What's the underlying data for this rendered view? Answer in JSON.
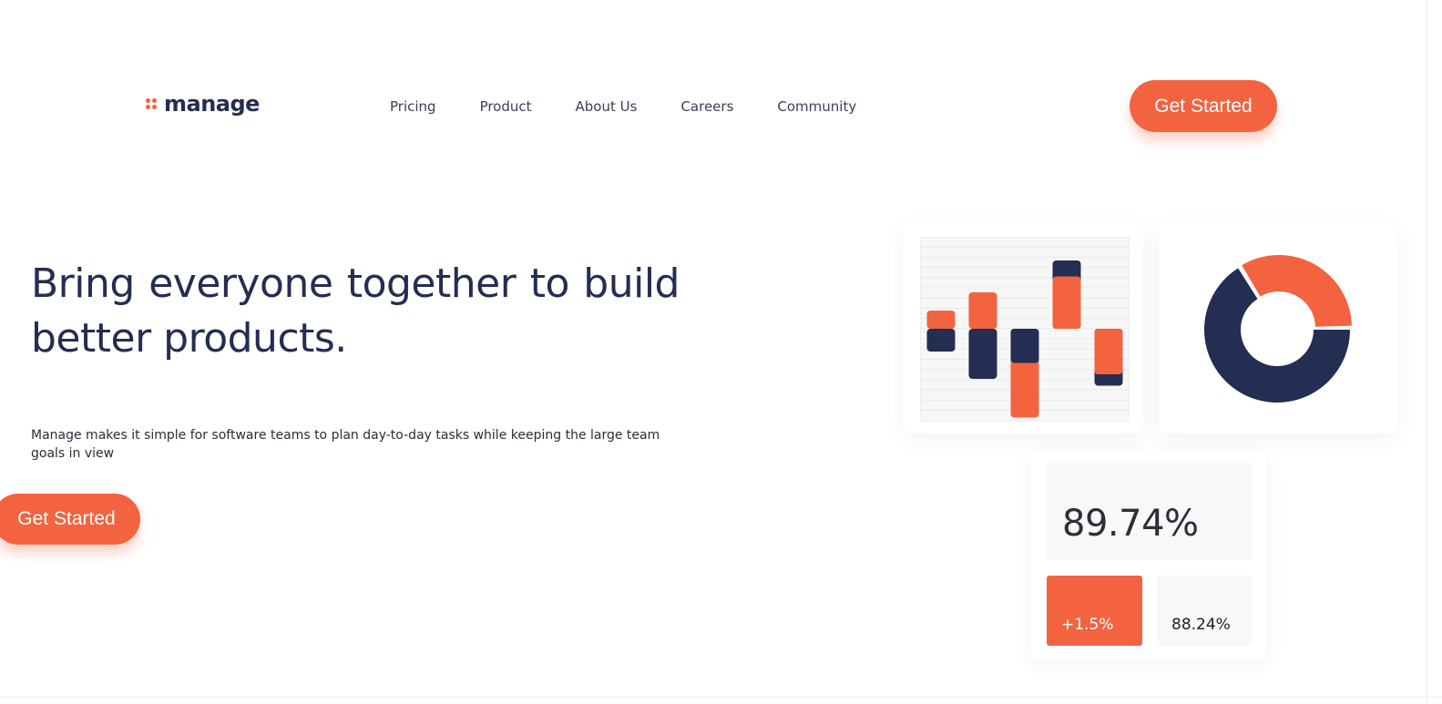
{
  "brand": {
    "name": "manage",
    "accent": "#f36340",
    "navy": "#242d52"
  },
  "nav": {
    "items": [
      {
        "label": "Pricing"
      },
      {
        "label": "Product"
      },
      {
        "label": "About Us"
      },
      {
        "label": "Careers"
      },
      {
        "label": "Community"
      }
    ]
  },
  "header": {
    "cta_label": "Get Started"
  },
  "hero": {
    "headline": "Bring everyone together to build better products.",
    "subtext": "Manage makes it simple for software teams to plan day-to-day tasks while keeping the large team goals in view",
    "cta_label": "Get Started"
  },
  "dashboard": {
    "bar_card": {
      "bars": [
        {
          "orange": 0.8,
          "navy": -1.0
        },
        {
          "orange": 1.6,
          "navy": -2.2
        },
        {
          "orange": -3.9,
          "navy": -1.5
        },
        {
          "orange": 2.3,
          "navy": 3.0
        },
        {
          "orange": -2.0,
          "navy": -2.5
        }
      ]
    },
    "donut_card": {
      "navy_share": 0.66,
      "orange_share": 0.34
    },
    "stats": {
      "main": "89.74%",
      "change": "+1.5%",
      "secondary": "88.24%"
    }
  }
}
